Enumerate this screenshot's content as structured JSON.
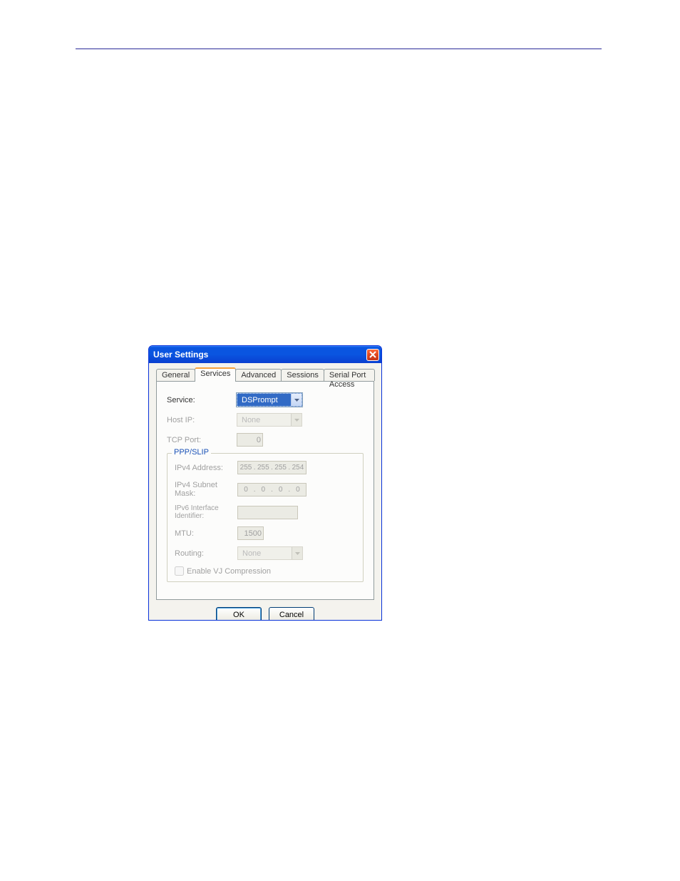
{
  "dialog": {
    "title": "User Settings",
    "tabs": [
      "General",
      "Services",
      "Advanced",
      "Sessions",
      "Serial Port Access"
    ],
    "activeTab": "Services",
    "buttons": {
      "ok": "OK",
      "cancel": "Cancel"
    }
  },
  "form": {
    "service": {
      "label": "Service:",
      "value": "DSPrompt"
    },
    "hostip": {
      "label": "Host IP:",
      "value": "None"
    },
    "tcpport": {
      "label": "TCP Port:",
      "value": "0"
    }
  },
  "pppslip": {
    "legend": "PPP/SLIP",
    "ipv4addr": {
      "label": "IPv4 Address:",
      "oct": [
        "255",
        "255",
        "255",
        "254"
      ]
    },
    "ipv4mask": {
      "label": "IPv4 Subnet Mask:",
      "oct": [
        "0",
        "0",
        "0",
        "0"
      ]
    },
    "ipv6iid": {
      "label": "IPv6 Interface Identifier:",
      "value": ""
    },
    "mtu": {
      "label": "MTU:",
      "value": "1500"
    },
    "routing": {
      "label": "Routing:",
      "value": "None"
    },
    "vj": {
      "label": "Enable VJ Compression"
    }
  }
}
